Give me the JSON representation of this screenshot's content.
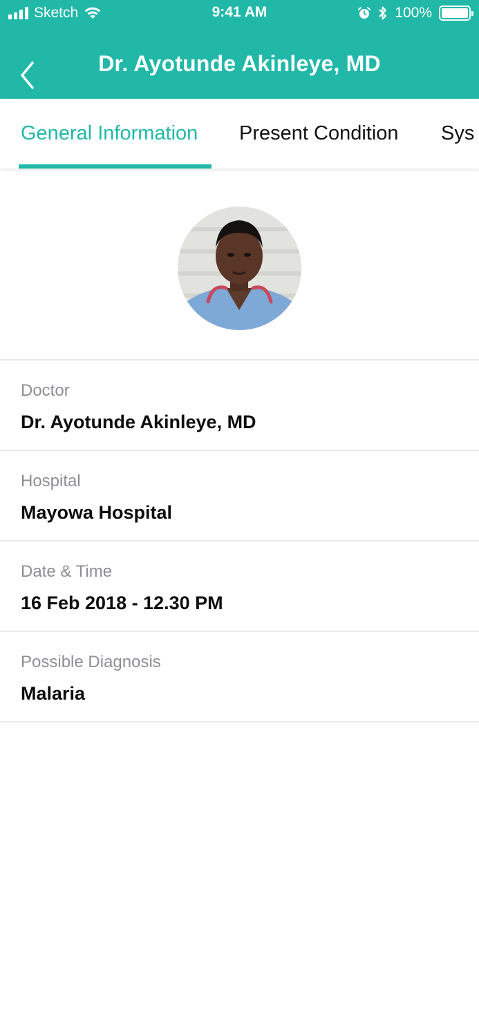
{
  "status_bar": {
    "carrier": "Sketch",
    "time": "9:41 AM",
    "battery": "100%",
    "icons": [
      "signal-icon",
      "wifi-icon",
      "alarm-icon",
      "bluetooth-icon",
      "battery-icon"
    ]
  },
  "header": {
    "title": "Dr. Ayotunde Akinleye, MD",
    "background_color": "#21b8a8",
    "back_icon": "chevron-left-icon"
  },
  "tabs": [
    {
      "label": "General Information",
      "active": true
    },
    {
      "label": "Present Condition",
      "active": false
    },
    {
      "label": "Sys",
      "active": false
    }
  ],
  "accent_color": "#21b8a8",
  "profile": {
    "avatar": "doctor-photo"
  },
  "details": [
    {
      "label": "Doctor",
      "value": "Dr. Ayotunde Akinleye, MD"
    },
    {
      "label": "Hospital",
      "value": "Mayowa Hospital"
    },
    {
      "label": "Date & Time",
      "value": "16 Feb 2018 - 12.30 PM"
    },
    {
      "label": "Possible Diagnosis",
      "value": "Malaria"
    }
  ]
}
